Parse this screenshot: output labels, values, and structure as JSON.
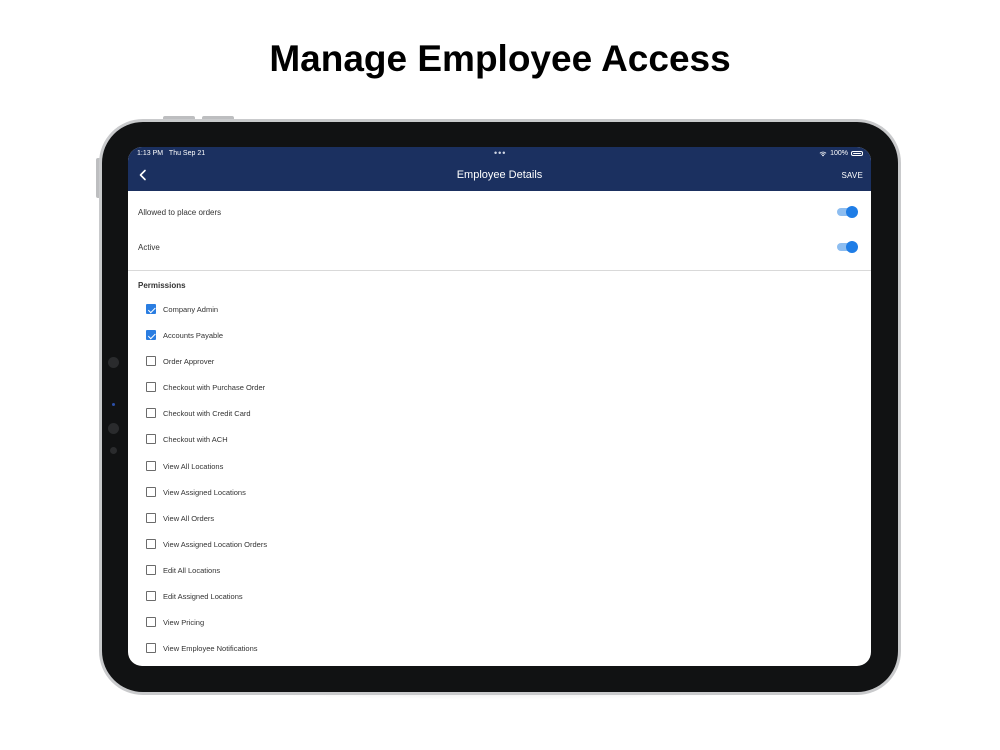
{
  "headline": "Manage Employee Access",
  "status_bar": {
    "time": "1:13 PM",
    "date": "Thu Sep 21",
    "dots": "•••",
    "battery": "100%"
  },
  "navbar": {
    "back_icon": "chevron-left-icon",
    "title": "Employee Details",
    "save_label": "SAVE"
  },
  "settings": [
    {
      "label": "Allowed to place orders",
      "on": true
    },
    {
      "label": "Active",
      "on": true
    }
  ],
  "permissions": {
    "heading": "Permissions",
    "items": [
      {
        "label": "Company Admin",
        "checked": true
      },
      {
        "label": "Accounts Payable",
        "checked": true
      },
      {
        "label": "Order Approver",
        "checked": false
      },
      {
        "label": "Checkout with Purchase Order",
        "checked": false
      },
      {
        "label": "Checkout with Credit Card",
        "checked": false
      },
      {
        "label": "Checkout with ACH",
        "checked": false
      },
      {
        "label": "View All Locations",
        "checked": false
      },
      {
        "label": "View Assigned Locations",
        "checked": false
      },
      {
        "label": "View All Orders",
        "checked": false
      },
      {
        "label": "View Assigned Location Orders",
        "checked": false
      },
      {
        "label": "Edit All Locations",
        "checked": false
      },
      {
        "label": "Edit Assigned Locations",
        "checked": false
      },
      {
        "label": "View Pricing",
        "checked": false
      },
      {
        "label": "View Employee Notifications",
        "checked": false
      }
    ]
  },
  "colors": {
    "navbar": "#1b3060",
    "accent": "#2a7de1",
    "toggle_track": "#8dbdf0"
  }
}
